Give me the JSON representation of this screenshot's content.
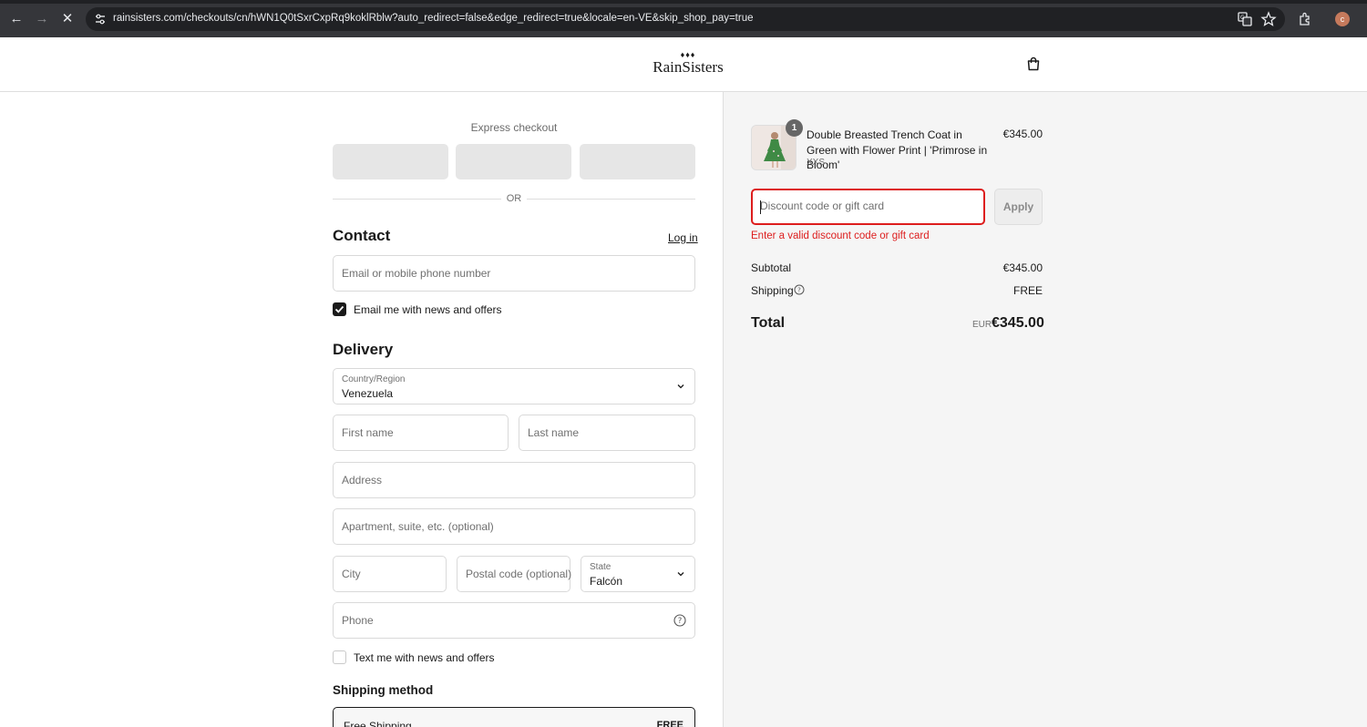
{
  "browser": {
    "url": "rainsisters.com/checkouts/cn/hWN1Q0tSxrCxpRq9koklRblw?auto_redirect=false&edge_redirect=true&locale=en-VE&skip_shop_pay=true",
    "profile_initial": "c"
  },
  "header": {
    "brand": "RainSisters",
    "drops": "♦♦♦"
  },
  "express": {
    "title": "Express checkout",
    "or_label": "OR"
  },
  "contact": {
    "title": "Contact",
    "login_link": "Log in",
    "email_placeholder": "Email or mobile phone number",
    "news_label": "Email me with news and offers",
    "news_checked": true
  },
  "delivery": {
    "title": "Delivery",
    "country_label": "Country/Region",
    "country_value": "Venezuela",
    "first_name_placeholder": "First name",
    "last_name_placeholder": "Last name",
    "address_placeholder": "Address",
    "apartment_placeholder": "Apartment, suite, etc. (optional)",
    "city_placeholder": "City",
    "postal_placeholder": "Postal code (optional)",
    "state_label": "State",
    "state_value": "Falcón",
    "phone_placeholder": "Phone",
    "sms_label": "Text me with news and offers",
    "sms_checked": false
  },
  "shipping_method": {
    "title": "Shipping method",
    "option_name": "Free Shipping",
    "option_price": "FREE"
  },
  "summary": {
    "item": {
      "quantity": "1",
      "name": "Double Breasted Trench Coat in Green with Flower Print | 'Primrose in Bloom'",
      "variant": "XXS",
      "price": "€345.00"
    },
    "discount_placeholder": "Discount code or gift card",
    "apply_label": "Apply",
    "error": "Enter a valid discount code or gift card",
    "subtotal_label": "Subtotal",
    "subtotal_value": "€345.00",
    "shipping_label": "Shipping",
    "shipping_value": "FREE",
    "total_label": "Total",
    "currency": "EUR",
    "total_value": "€345.00"
  },
  "colors": {
    "error": "#dd1d1d",
    "panel_bg": "#f5f5f5",
    "chrome_bg": "#35363a"
  }
}
